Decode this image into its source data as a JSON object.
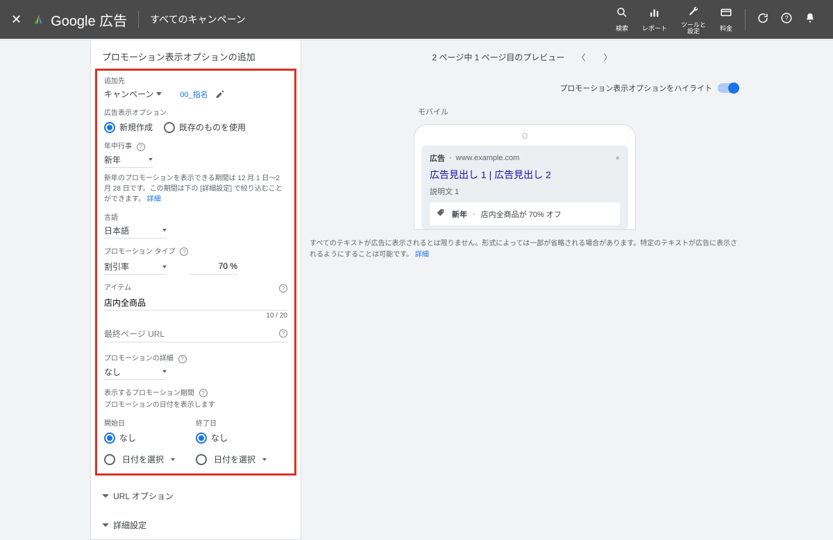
{
  "topbar": {
    "logo_text": "Google 広告",
    "subtitle": "すべてのキャンペーン",
    "tools": {
      "search": "検索",
      "report": "レポート",
      "tools": "ツールと\n設定",
      "billing": "料金"
    }
  },
  "panel": {
    "title": "プロモーション表示オプションの追加",
    "add_to_label": "追加先",
    "add_to_value": "キャンペーン",
    "campaign_tag": "00_指名",
    "ext_option_label": "広告表示オプション",
    "radio_new": "新規作成",
    "radio_existing": "既存のものを使用",
    "occasion_label": "年中行事",
    "occasion_value": "新年",
    "occasion_note": "新年のプロモーションを表示できる期間は 12 月 1 日～2 月 28 日です。この期間は下の [詳細設定] で絞り込むことができます。",
    "occasion_note_link": "詳細",
    "lang_label": "言語",
    "lang_value": "日本語",
    "type_label": "プロモーション タイプ",
    "type_value": "割引率",
    "discount_value": "70 %",
    "item_label": "アイテム",
    "item_value": "店内全商品",
    "item_counter": "10 / 20",
    "final_url_label": "最終ページ URL",
    "detail_label": "プロモーションの詳細",
    "detail_value": "なし",
    "period_label": "表示するプロモーション期間",
    "period_note": "プロモーションの日付を表示します",
    "start_label": "開始日",
    "end_label": "終了日",
    "none": "なし",
    "select_date": "日付を選択",
    "url_options": "URL オプション",
    "adv_settings": "詳細設定"
  },
  "preview": {
    "pager": "2 ページ中 1 ページ目のプレビュー",
    "toggle_label": "プロモーション表示オプションをハイライト",
    "device_label": "モバイル",
    "ad_badge": "広告",
    "ad_url": "www.example.com",
    "ad_title": "広告見出し 1 | 広告見出し 2",
    "ad_desc": "説明文 1",
    "tag_name": "新年",
    "tag_text": "店内全商品が 70% オフ",
    "disclaimer": "すべてのテキストが広告に表示されるとは限りません。形式によっては一部が省略される場合があります。特定のテキストが広告に表示されるようにすることは可能です。",
    "disclaimer_link": "詳細"
  }
}
